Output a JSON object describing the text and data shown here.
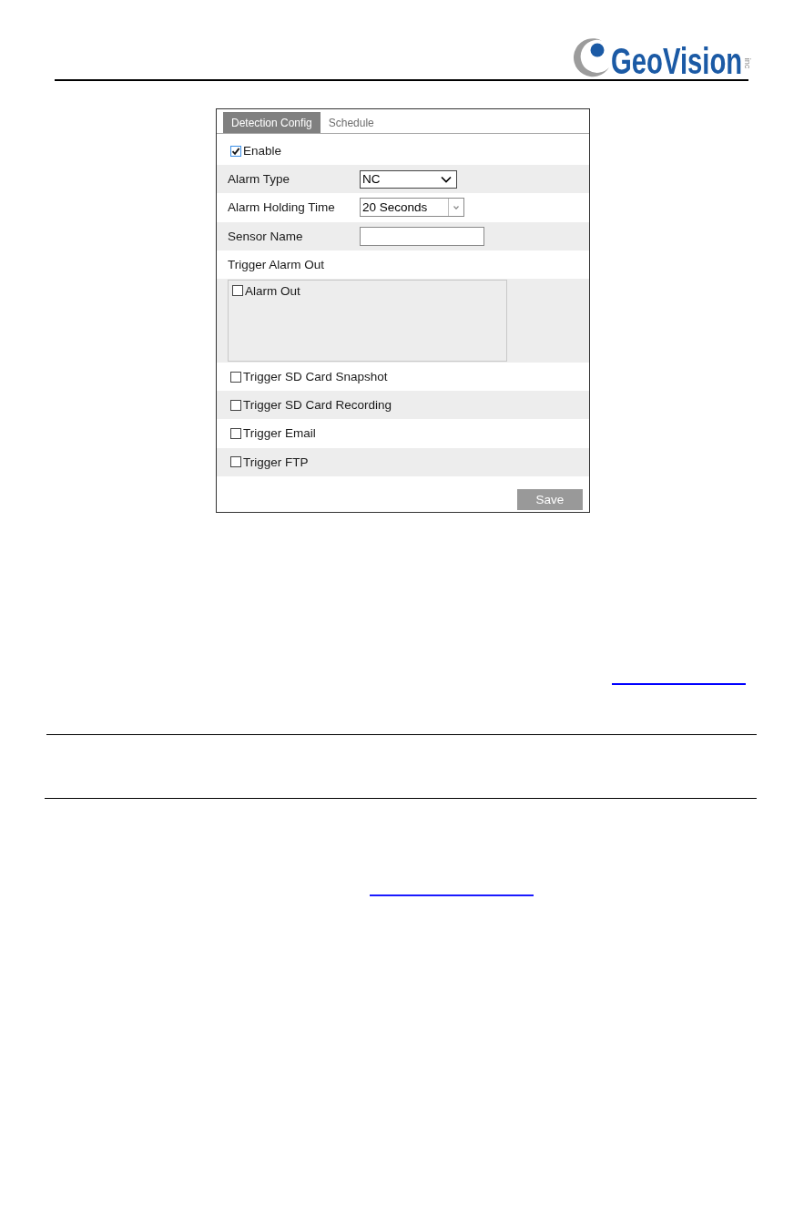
{
  "header": {
    "logo": {
      "wordmark": "GeoVision",
      "suffix": "inc"
    }
  },
  "panel": {
    "tabs": [
      {
        "label": "Detection Config",
        "selected": true
      },
      {
        "label": "Schedule",
        "selected": false
      }
    ],
    "rows": [
      {
        "kind": "checkbox",
        "label": "Enable",
        "checked": true
      },
      {
        "kind": "select",
        "label": "Alarm Type",
        "value": "NC"
      },
      {
        "kind": "combo",
        "label": "Alarm Holding Time",
        "value": "20 Seconds"
      },
      {
        "kind": "text",
        "label": "Sensor Name"
      },
      {
        "kind": "heading",
        "label": "Trigger Alarm Out"
      },
      {
        "kind": "list",
        "items": [
          {
            "label": "Alarm Out",
            "checked": false
          }
        ]
      },
      {
        "kind": "checkbox",
        "label": "Trigger SD Card Snapshot",
        "checked": false
      },
      {
        "kind": "checkbox",
        "label": "Trigger SD Card Recording",
        "checked": false
      },
      {
        "kind": "checkbox",
        "label": "Trigger Email",
        "checked": false
      },
      {
        "kind": "checkbox",
        "label": "Trigger FTP",
        "checked": false
      }
    ],
    "save_button": "Save"
  }
}
